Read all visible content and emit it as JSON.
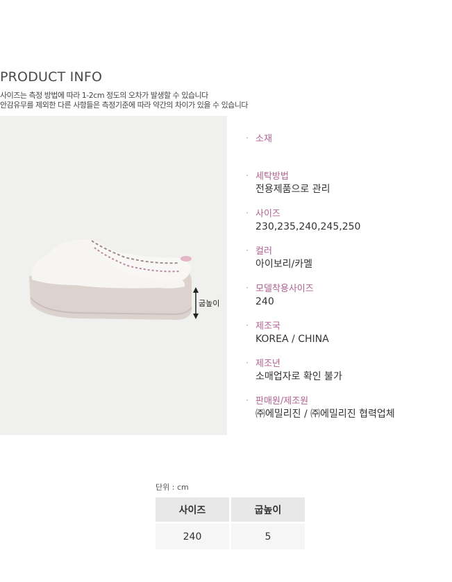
{
  "header": {
    "title": "PRODUCT INFO",
    "notice_line1": "사이즈는 측정 방법에 따라 1-2cm 정도의 오차가 발생할 수 있습니다",
    "notice_line2": "안감유무를 제외한 다른 사항들은 측정기준에 따라 약간의 차이가 있을 수 있습니다"
  },
  "photo": {
    "height_label": "굽높이"
  },
  "info": {
    "bullet": "·",
    "items": [
      {
        "label": "소재",
        "value": ""
      },
      {
        "label": "세탁방법",
        "value": "전용제품으로 관리"
      },
      {
        "label": "사이즈",
        "value": "230,235,240,245,250"
      },
      {
        "label": "컬러",
        "value": "아이보리/카멜"
      },
      {
        "label": "모델착용사이즈",
        "value": "240"
      },
      {
        "label": "제조국",
        "value": "KOREA / CHINA"
      },
      {
        "label": "제조년",
        "value": "소매업자로 확인 불가"
      },
      {
        "label": "판매원/제조원",
        "value": "㈜에밀리진 / ㈜에밀리진 협력업체"
      }
    ]
  },
  "size_table": {
    "unit": "단위 : cm",
    "headers": [
      "사이즈",
      "굽높이"
    ],
    "rows": [
      [
        "240",
        "5"
      ]
    ]
  },
  "colors": {
    "label_accent": "#b06190",
    "photo_bg": "#f0f0ef"
  }
}
